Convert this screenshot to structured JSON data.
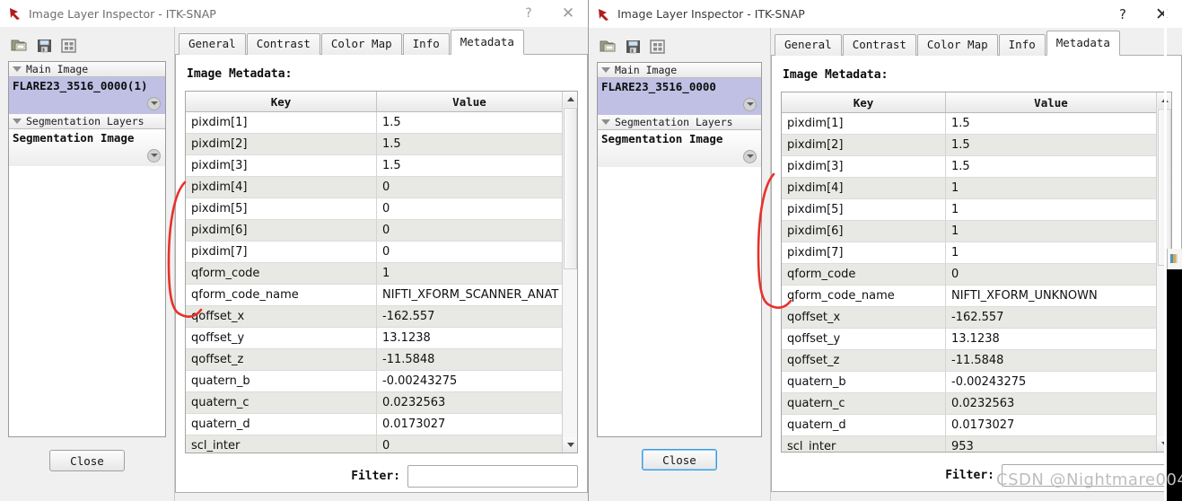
{
  "windows": [
    {
      "id": "left",
      "title": "Image Layer Inspector - ITK-SNAP",
      "help_label": "?",
      "close_label": "✕",
      "toolbar": [
        {
          "name": "open-image-icon",
          "tip": "Open Image"
        },
        {
          "name": "save-image-icon",
          "tip": "Save Image"
        },
        {
          "name": "layer-table-icon",
          "tip": "Layer Table"
        }
      ],
      "layers": {
        "main_group_label": "Main Image",
        "main_layer_label": "FLARE23_3516_0000(1)",
        "seg_group_label": "Segmentation Layers",
        "seg_layer_label": "Segmentation Image"
      },
      "close_button": "Close",
      "close_button_focused": false,
      "tabs": [
        {
          "label": "General",
          "active": false
        },
        {
          "label": "Contrast",
          "active": false
        },
        {
          "label": "Color Map",
          "active": false
        },
        {
          "label": "Info",
          "active": false
        },
        {
          "label": "Metadata",
          "active": true
        }
      ],
      "section_title": "Image Metadata:",
      "table": {
        "columns": [
          "Key",
          "Value"
        ],
        "first_row_shading": "white",
        "rows": [
          [
            "pixdim[1]",
            "1.5"
          ],
          [
            "pixdim[2]",
            "1.5"
          ],
          [
            "pixdim[3]",
            "1.5"
          ],
          [
            "pixdim[4]",
            "0"
          ],
          [
            "pixdim[5]",
            "0"
          ],
          [
            "pixdim[6]",
            "0"
          ],
          [
            "pixdim[7]",
            "0"
          ],
          [
            "qform_code",
            "1"
          ],
          [
            "qform_code_name",
            "NIFTI_XFORM_SCANNER_ANAT"
          ],
          [
            "qoffset_x",
            "-162.557"
          ],
          [
            "qoffset_y",
            "13.1238"
          ],
          [
            "qoffset_z",
            "-11.5848"
          ],
          [
            "quatern_b",
            "-0.00243275"
          ],
          [
            "quatern_c",
            "0.0232563"
          ],
          [
            "quatern_d",
            "0.0173027"
          ],
          [
            "scl_inter",
            "0"
          ],
          [
            "",
            ""
          ]
        ]
      },
      "filter": {
        "label": "Filter:",
        "value": "",
        "placeholder": ""
      }
    },
    {
      "id": "right",
      "title": "Image Layer Inspector - ITK-SNAP",
      "help_label": "?",
      "close_label": "✕",
      "toolbar": [
        {
          "name": "open-image-icon",
          "tip": "Open Image"
        },
        {
          "name": "save-image-icon",
          "tip": "Save Image"
        },
        {
          "name": "layer-table-icon",
          "tip": "Layer Table"
        }
      ],
      "layers": {
        "main_group_label": "Main Image",
        "main_layer_label": "FLARE23_3516_0000",
        "seg_group_label": "Segmentation Layers",
        "seg_layer_label": "Segmentation Image"
      },
      "close_button": "Close",
      "close_button_focused": true,
      "tabs": [
        {
          "label": "General",
          "active": false
        },
        {
          "label": "Contrast",
          "active": false
        },
        {
          "label": "Color Map",
          "active": false
        },
        {
          "label": "Info",
          "active": false
        },
        {
          "label": "Metadata",
          "active": true
        }
      ],
      "section_title": "Image Metadata:",
      "table": {
        "columns": [
          "Key",
          "Value"
        ],
        "first_row_shading": "white",
        "rows": [
          [
            "pixdim[1]",
            "1.5"
          ],
          [
            "pixdim[2]",
            "1.5"
          ],
          [
            "pixdim[3]",
            "1.5"
          ],
          [
            "pixdim[4]",
            "1"
          ],
          [
            "pixdim[5]",
            "1"
          ],
          [
            "pixdim[6]",
            "1"
          ],
          [
            "pixdim[7]",
            "1"
          ],
          [
            "qform_code",
            "0"
          ],
          [
            "qform_code_name",
            "NIFTI_XFORM_UNKNOWN"
          ],
          [
            "qoffset_x",
            "-162.557"
          ],
          [
            "qoffset_y",
            "13.1238"
          ],
          [
            "qoffset_z",
            "-11.5848"
          ],
          [
            "quatern_b",
            "-0.00243275"
          ],
          [
            "quatern_c",
            "0.0232563"
          ],
          [
            "quatern_d",
            "0.0173027"
          ],
          [
            "scl_inter",
            "953"
          ],
          [
            "",
            ""
          ]
        ]
      },
      "filter": {
        "label": "Filter:",
        "value": "",
        "placeholder": ""
      }
    }
  ],
  "annotations": {
    "color": "#e8312a",
    "marks": [
      {
        "name": "left-bracket",
        "note": "red curved brace beside pixdim[4]..qoffset_x rows in left window"
      },
      {
        "name": "right-bracket",
        "note": "red curved brace beside pixdim[4]..qoffset_x rows in right window"
      }
    ]
  },
  "watermark": {
    "text": "CSDN @Nightmare004",
    "color": "#bdbdbd"
  }
}
